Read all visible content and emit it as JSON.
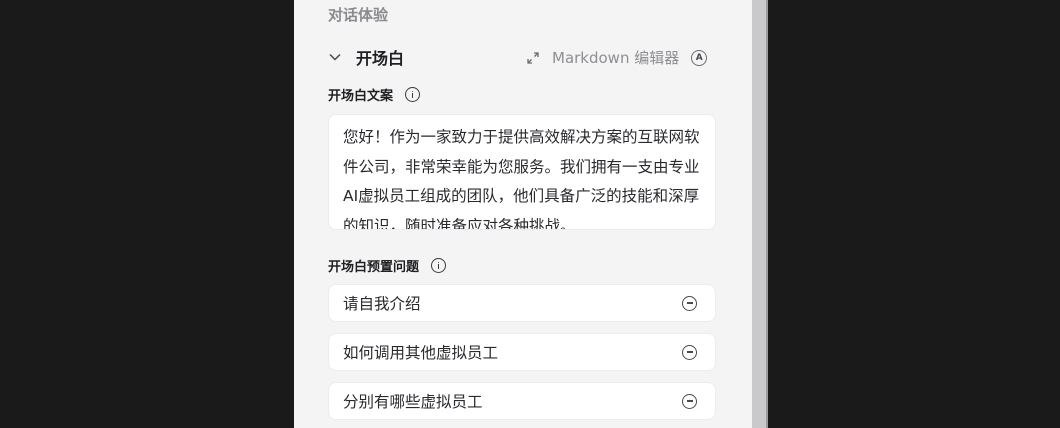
{
  "section": {
    "title": "对话体验"
  },
  "opening": {
    "collapse_title": "开场白",
    "markdown_editor_label": "Markdown 编辑器",
    "markdown_badge": "A"
  },
  "opening_text": {
    "label": "开场白文案",
    "value": "您好！作为一家致力于提供高效解决方案的互联网软件公司，非常荣幸能为您服务。我们拥有一支由专业AI虚拟员工组成的团队，他们具备广泛的技能和深厚的知识，随时准备应对各种挑战。"
  },
  "preset_questions": {
    "label": "开场白预置问题",
    "items": [
      {
        "text": "请自我介绍"
      },
      {
        "text": "如何调用其他虚拟员工"
      },
      {
        "text": "分别有哪些虚拟员工"
      }
    ]
  }
}
